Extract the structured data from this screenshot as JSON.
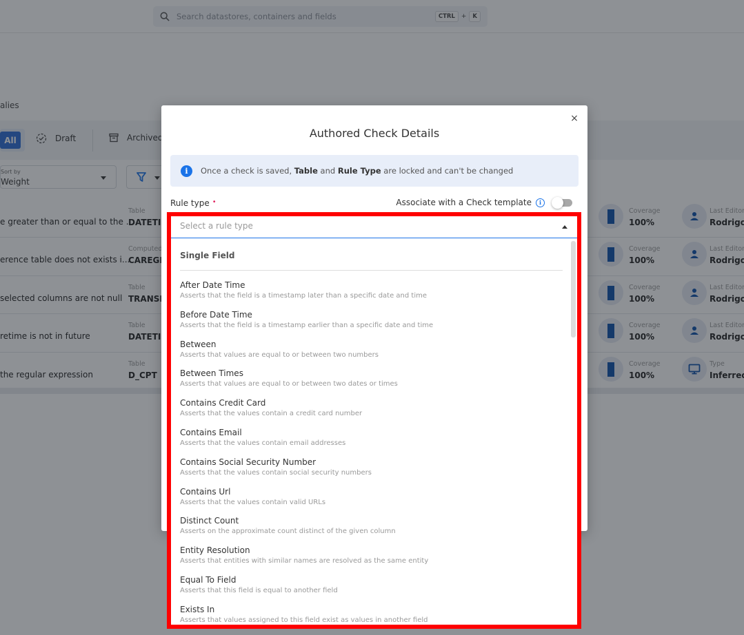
{
  "search": {
    "placeholder": "Search datastores, containers and fields",
    "shortcut_key1": "CTRL",
    "shortcut_plus": "+",
    "shortcut_key2": "K"
  },
  "breadcrumb": "alies",
  "tabs": [
    {
      "label": "All",
      "active": true
    },
    {
      "label": "Draft"
    },
    {
      "label": "Archived"
    }
  ],
  "sort": {
    "label": "Sort by",
    "value": "Weight"
  },
  "rows": [
    {
      "description": "e greater than or equal to the ...",
      "table_label": "Table",
      "table": "DATETIM",
      "coverage_label": "Coverage",
      "coverage": "100%",
      "meta_label": "Last Editor",
      "meta_value": "Rodrigo",
      "meta_icon": "user-icon"
    },
    {
      "description": "erence table does not exists i...",
      "table_label": "Computed",
      "table": "CAREGIV",
      "coverage_label": "Coverage",
      "coverage": "100%",
      "meta_label": "Last Editor",
      "meta_value": "Rodrigo",
      "meta_icon": "user-icon"
    },
    {
      "description": "selected columns are not null",
      "table_label": "Table",
      "table": "TRANSFE",
      "coverage_label": "Coverage",
      "coverage": "100%",
      "meta_label": "Last Editor",
      "meta_value": "Rodrigo",
      "meta_icon": "user-icon"
    },
    {
      "description": "retime is not in future",
      "table_label": "Table",
      "table": "DATETIM",
      "coverage_label": "Coverage",
      "coverage": "100%",
      "meta_label": "Last Editor",
      "meta_value": "Rodrigo",
      "meta_icon": "user-icon"
    },
    {
      "description": " the regular expression",
      "table_label": "Table",
      "table": "D_CPT",
      "coverage_label": "Coverage",
      "coverage": "100%",
      "meta_label": "Type",
      "meta_value": "Inferred",
      "meta_icon": "monitor-icon"
    }
  ],
  "modal": {
    "title": "Authored Check Details",
    "close_icon": "×",
    "info_pre": "Once a check is saved, ",
    "info_b1": "Table",
    "info_mid": " and ",
    "info_b2": "Rule Type",
    "info_post": " are locked and can't be changed",
    "rule_type_label": "Rule type",
    "required_mark": "•",
    "associate_label": "Associate with a Check template",
    "associate_toggle_on": false,
    "select_placeholder": "Select a rule type",
    "group_header": "Single Field",
    "options": [
      {
        "title": "After Date Time",
        "desc": "Asserts that the field is a timestamp later than a specific date and time"
      },
      {
        "title": "Before Date Time",
        "desc": "Asserts that the field is a timestamp earlier than a specific date and time"
      },
      {
        "title": "Between",
        "desc": "Asserts that values are equal to or between two numbers"
      },
      {
        "title": "Between Times",
        "desc": "Asserts that values are equal to or between two dates or times"
      },
      {
        "title": "Contains Credit Card",
        "desc": "Asserts that the values contain a credit card number"
      },
      {
        "title": "Contains Email",
        "desc": "Asserts that the values contain email addresses"
      },
      {
        "title": "Contains Social Security Number",
        "desc": "Asserts that the values contain social security numbers"
      },
      {
        "title": "Contains Url",
        "desc": "Asserts that the values contain valid URLs"
      },
      {
        "title": "Distinct Count",
        "desc": "Asserts on the approximate count distinct of the given column"
      },
      {
        "title": "Entity Resolution",
        "desc": "Asserts that entities with similar names are resolved as the same entity"
      },
      {
        "title": "Equal To Field",
        "desc": "Asserts that this field is equal to another field"
      },
      {
        "title": "Exists In",
        "desc": "Asserts that values assigned to this field exist as values in another field"
      }
    ]
  },
  "colors": {
    "accent": "#1a73e8",
    "primary_button": "#2a6bd4",
    "highlight": "#ff0000",
    "coverage_bar": "#0a4ea8"
  }
}
